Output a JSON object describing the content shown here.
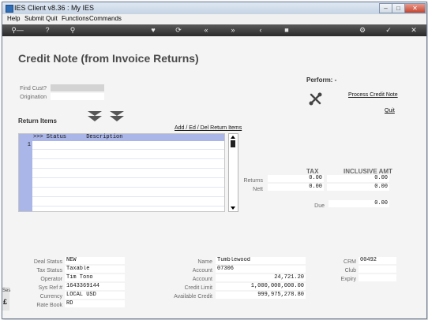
{
  "window": {
    "title": "IES Client v8.36 : My IES"
  },
  "menu": [
    "Help",
    "Submit",
    "Quit",
    "Functions",
    "Commands"
  ],
  "toolbar": {
    "icons": [
      "key-icon",
      "help-icon",
      "search-icon",
      "heart-icon",
      "refresh-icon",
      "rewind-icon",
      "fast-forward-icon",
      "back-icon",
      "stop-icon",
      "settings-icon",
      "check-icon",
      "close-icon"
    ]
  },
  "page": {
    "title": "Credit Note (from Invoice Returns)"
  },
  "search": {
    "find_cust_label": "Find Cust?",
    "find_cust_value": "",
    "origination_label": "Origination",
    "origination_value": ""
  },
  "perform": {
    "label": "Perform: -",
    "process_link": "Process Credit Note",
    "quit_link": "Quit"
  },
  "return_items": {
    "label": "Return Items",
    "add_link": "Add / Ed / Del Return Items",
    "header": ">>> Status      Description",
    "row_number": "1"
  },
  "totals": {
    "tax_header": "TAX",
    "incl_header": "INCLUSIVE AMT",
    "returns_label": "Returns",
    "nett_label": "Nett",
    "due_label": "Due",
    "returns_tax": "0.00",
    "returns_incl": "0.00",
    "nett_tax": "0.00",
    "nett_incl": "0.00",
    "due_value": "0.00"
  },
  "deal": {
    "deal_status_label": "Deal Status",
    "deal_status": "NEW",
    "tax_status_label": "Tax Status",
    "tax_status": "Taxable",
    "operator_label": "Operator",
    "operator": "Tim Tono",
    "sys_ref_label": "Sys Ref #",
    "sys_ref": "1643369144",
    "currency_label": "Currency",
    "currency": "LOCAL USD",
    "rate_book_label": "Rate Book",
    "rate_book": "RD"
  },
  "customer": {
    "name_label": "Name",
    "name": "Tumblewood",
    "account_label": "Account",
    "account": "07306",
    "account2_label": "Account",
    "account2": "24,721.20",
    "credit_limit_label": "Credit Limit",
    "credit_limit": "1,000,000,000.00",
    "available_credit_label": "Available Credit",
    "available_credit": "999,975,278.80"
  },
  "crm": {
    "crm_label": "CRM",
    "crm": "00492",
    "club_label": "Club",
    "club": "",
    "expiry_label": "Expiry",
    "expiry": ""
  },
  "side_fragment": {
    "text": "Ses"
  }
}
